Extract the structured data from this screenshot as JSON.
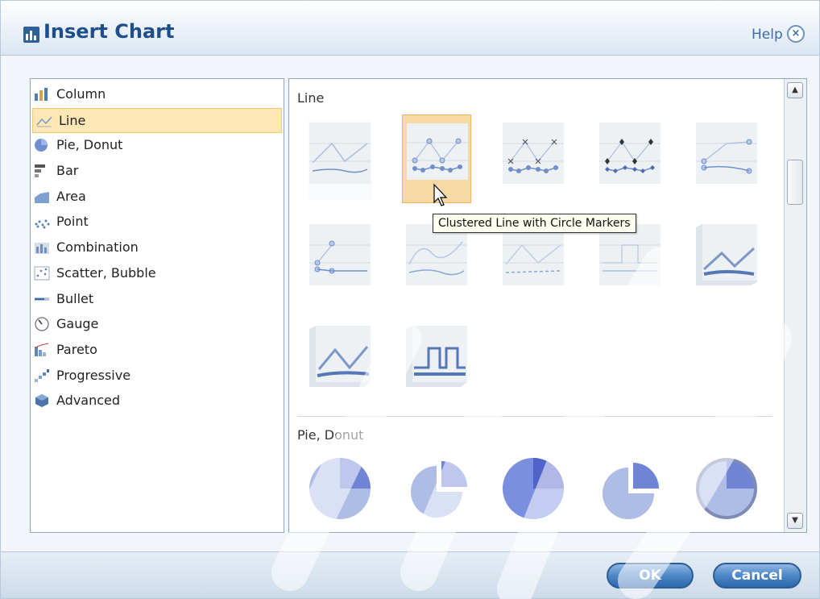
{
  "dialog": {
    "title": "Insert Chart",
    "help": "Help",
    "close_symbol": "×"
  },
  "chart_types": [
    {
      "label": "Column",
      "icon": "column-chart-icon"
    },
    {
      "label": "Line",
      "icon": "line-chart-icon",
      "selected": true
    },
    {
      "label": "Pie, Donut",
      "icon": "pie-chart-icon"
    },
    {
      "label": "Bar",
      "icon": "bar-chart-icon"
    },
    {
      "label": "Area",
      "icon": "area-chart-icon"
    },
    {
      "label": "Point",
      "icon": "point-chart-icon"
    },
    {
      "label": "Combination",
      "icon": "combination-chart-icon"
    },
    {
      "label": "Scatter, Bubble",
      "icon": "scatter-chart-icon"
    },
    {
      "label": "Bullet",
      "icon": "bullet-chart-icon"
    },
    {
      "label": "Gauge",
      "icon": "gauge-chart-icon"
    },
    {
      "label": "Pareto",
      "icon": "pareto-chart-icon"
    },
    {
      "label": "Progressive",
      "icon": "progressive-chart-icon"
    },
    {
      "label": "Advanced",
      "icon": "advanced-chart-icon"
    }
  ],
  "gallery": {
    "line_section": "Line",
    "pie_section": "Pie, Donut",
    "tooltip": "Clustered Line with Circle Markers"
  },
  "buttons": {
    "ok": "OK",
    "cancel": "Cancel"
  },
  "colors": {
    "selection": "#fde7b6",
    "accent": "#1f4e8c",
    "button": "#3f79bd"
  }
}
